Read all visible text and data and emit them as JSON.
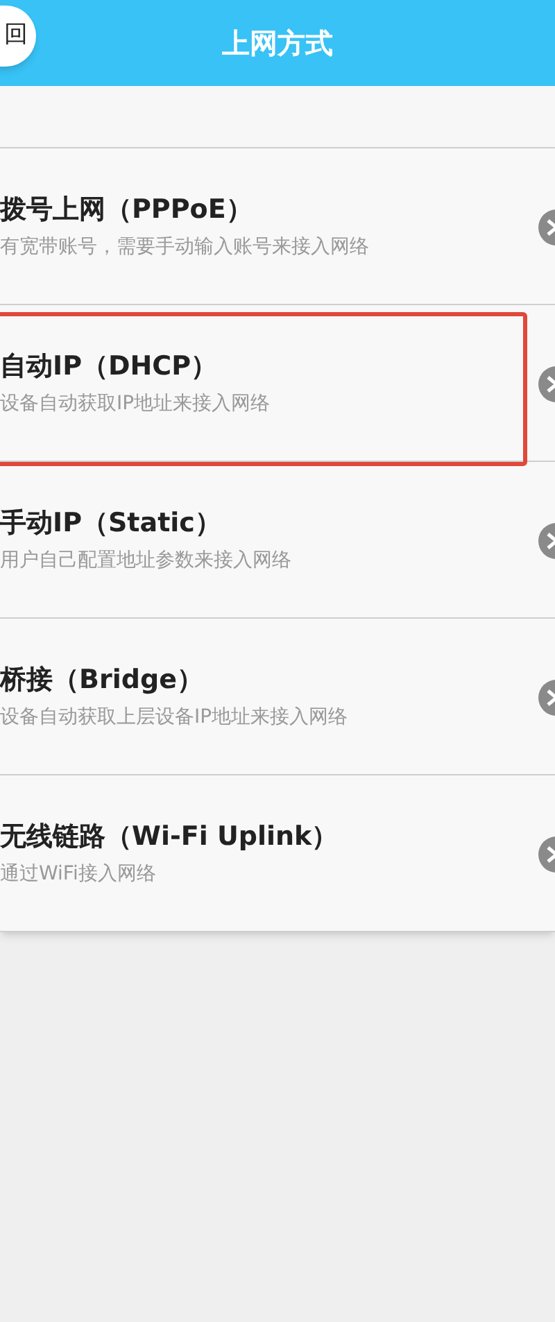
{
  "header": {
    "back_button": "回",
    "title": "上网方式"
  },
  "options": [
    {
      "title": "拨号上网（PPPoE）",
      "description": "有宽带账号，需要手动输入账号来接入网络",
      "highlighted": false
    },
    {
      "title": "自动IP（DHCP）",
      "description": "设备自动获取IP地址来接入网络",
      "highlighted": true
    },
    {
      "title": "手动IP（Static）",
      "description": "用户自己配置地址参数来接入网络",
      "highlighted": false
    },
    {
      "title": "桥接（Bridge）",
      "description": "设备自动获取上层设备IP地址来接入网络",
      "highlighted": false
    },
    {
      "title": "无线链路（Wi-Fi Uplink）",
      "description": "通过WiFi接入网络",
      "highlighted": false
    }
  ]
}
